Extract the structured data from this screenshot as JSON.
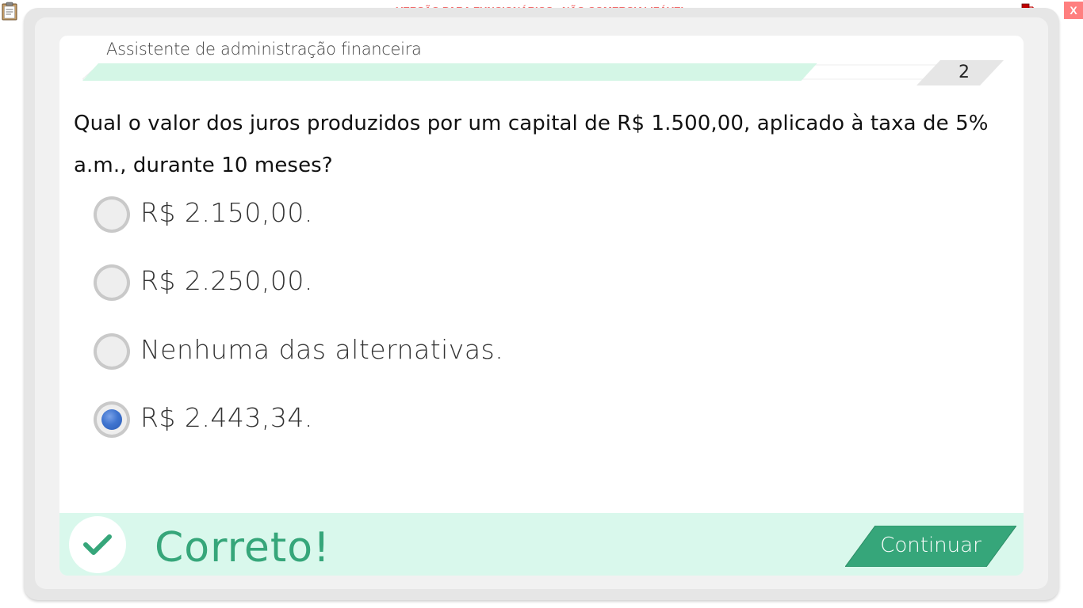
{
  "window": {
    "watermark": "VERSÃO PARA FUNCIONÁRIOS - NÃO COMERCIALIZÁVEL",
    "close_label": "X",
    "icons": [
      "clipboard-icon",
      "network-status-icon"
    ]
  },
  "header": {
    "course_title": "Assistente de administração financeira",
    "page_number": "2",
    "progress_fraction": 0.82
  },
  "question": {
    "text": "Qual o valor dos juros produzidos por um capital de R$ 1.500,00, aplicado à taxa de 5% a.m., durante 10 meses?"
  },
  "options": [
    {
      "label": "R$ 2.150,00.",
      "selected": false
    },
    {
      "label": "R$ 2.250,00.",
      "selected": false
    },
    {
      "label": "Nenhuma das alternativas.",
      "selected": false
    },
    {
      "label": "R$ 2.443,34.",
      "selected": true
    }
  ],
  "feedback": {
    "status": "Correto!",
    "continue_label": "Continuar",
    "icon": "check-icon"
  },
  "colors": {
    "accent_green": "#36a67a",
    "feedback_bg": "#d9f8ec",
    "progress_fill": "#d4f6e6",
    "watermark_red": "#f26d6d",
    "close_red": "#ff7f7f",
    "selected_blue": "#3f74cf"
  }
}
